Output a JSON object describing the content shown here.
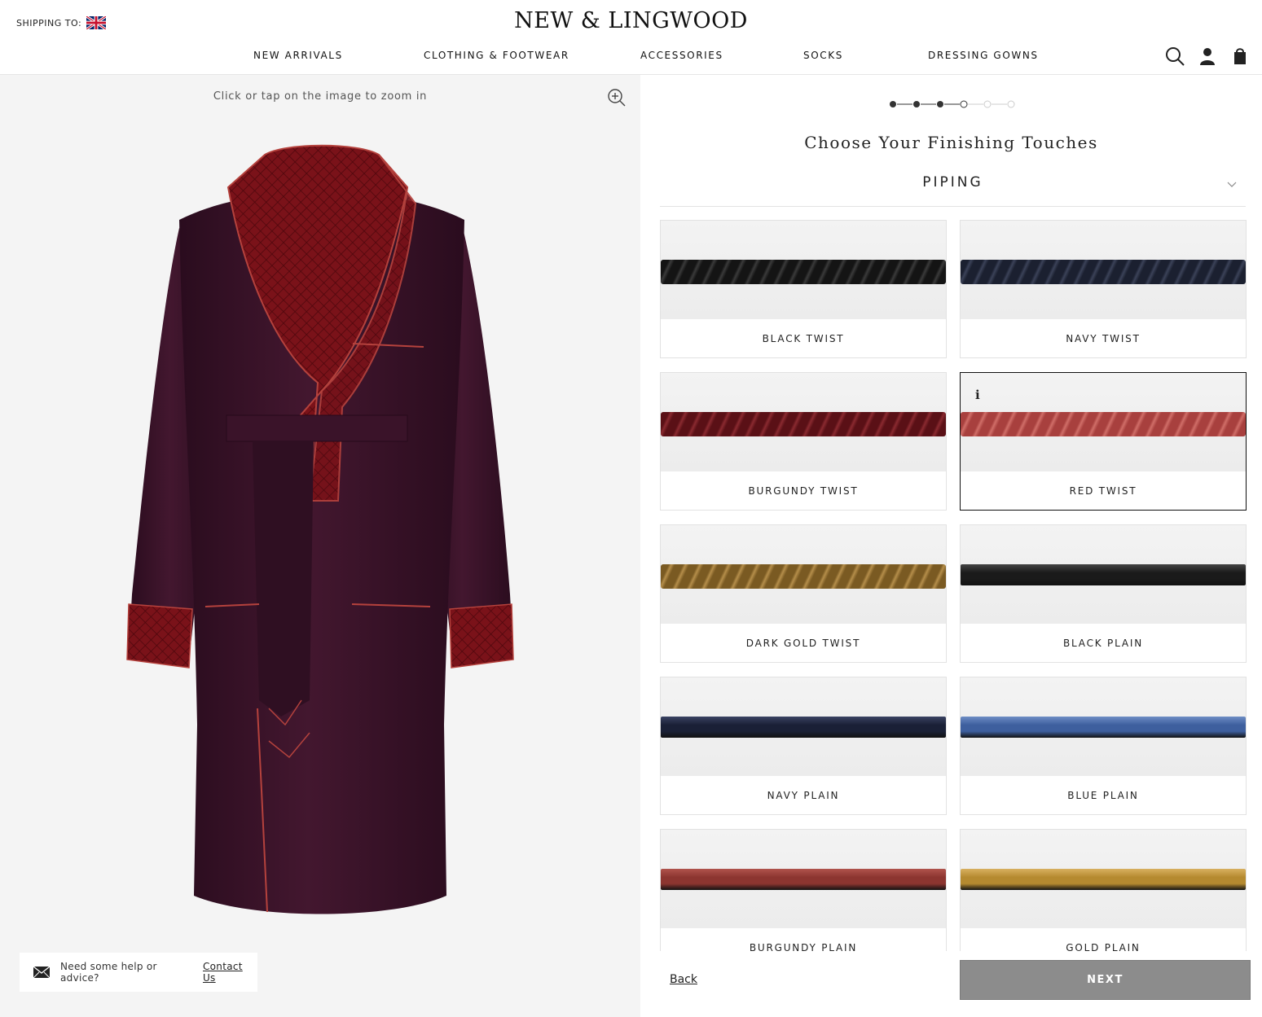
{
  "header": {
    "shipping_label": "SHIPPING TO:",
    "flag_icon": "uk-flag-icon",
    "logo": "NEW & LINGWOOD",
    "nav": [
      "NEW ARRIVALS",
      "CLOTHING & FOOTWEAR",
      "ACCESSORIES",
      "SOCKS",
      "DRESSING GOWNS"
    ],
    "icons": [
      "search-icon",
      "account-icon",
      "bag-icon"
    ]
  },
  "viewer": {
    "zoom_hint": "Click or tap on the image to zoom in",
    "zoom_icon": "zoom-in-icon",
    "image_alt": "Dressing gown preview",
    "help_text": "Need some help or advice?",
    "help_link": "Contact Us",
    "help_icon": "mail-icon"
  },
  "configurator": {
    "progress": {
      "total_steps": 6,
      "completed": 3,
      "current": 4
    },
    "title": "Choose Your Finishing Touches",
    "section": "PIPING",
    "selected": "RED TWIST",
    "options": [
      {
        "label": "BLACK TWIST",
        "style": "twist",
        "color": "#141414",
        "stripe": "#3a3a3a"
      },
      {
        "label": "NAVY TWIST",
        "style": "twist",
        "color": "#1b2030",
        "stripe": "#3b4258"
      },
      {
        "label": "BURGUNDY TWIST",
        "style": "twist",
        "color": "#5a1016",
        "stripe": "#8a2a30"
      },
      {
        "label": "RED TWIST",
        "style": "twist",
        "color": "#a8403e",
        "stripe": "#d06e68"
      },
      {
        "label": "DARK GOLD TWIST",
        "style": "twist",
        "color": "#7a5a22",
        "stripe": "#b58e4a"
      },
      {
        "label": "BLACK PLAIN",
        "style": "plain",
        "color": "#1a1a1a",
        "stripe": "#444444"
      },
      {
        "label": "NAVY PLAIN",
        "style": "plain",
        "color": "#1a2036",
        "stripe": "#394262"
      },
      {
        "label": "BLUE PLAIN",
        "style": "plain",
        "color": "#3e5f9e",
        "stripe": "#6d8cc4"
      },
      {
        "label": "BURGUNDY PLAIN",
        "style": "plain",
        "color": "#8c3530",
        "stripe": "#b0534c"
      },
      {
        "label": "GOLD PLAIN",
        "style": "plain",
        "color": "#b58a30",
        "stripe": "#d8b060"
      }
    ],
    "back_label": "Back",
    "next_label": "NEXT"
  },
  "colors": {
    "gown": "#3a1329",
    "lapel": "#7a1219",
    "piping": "#b5423d",
    "next_button": "#8c8c8c"
  }
}
